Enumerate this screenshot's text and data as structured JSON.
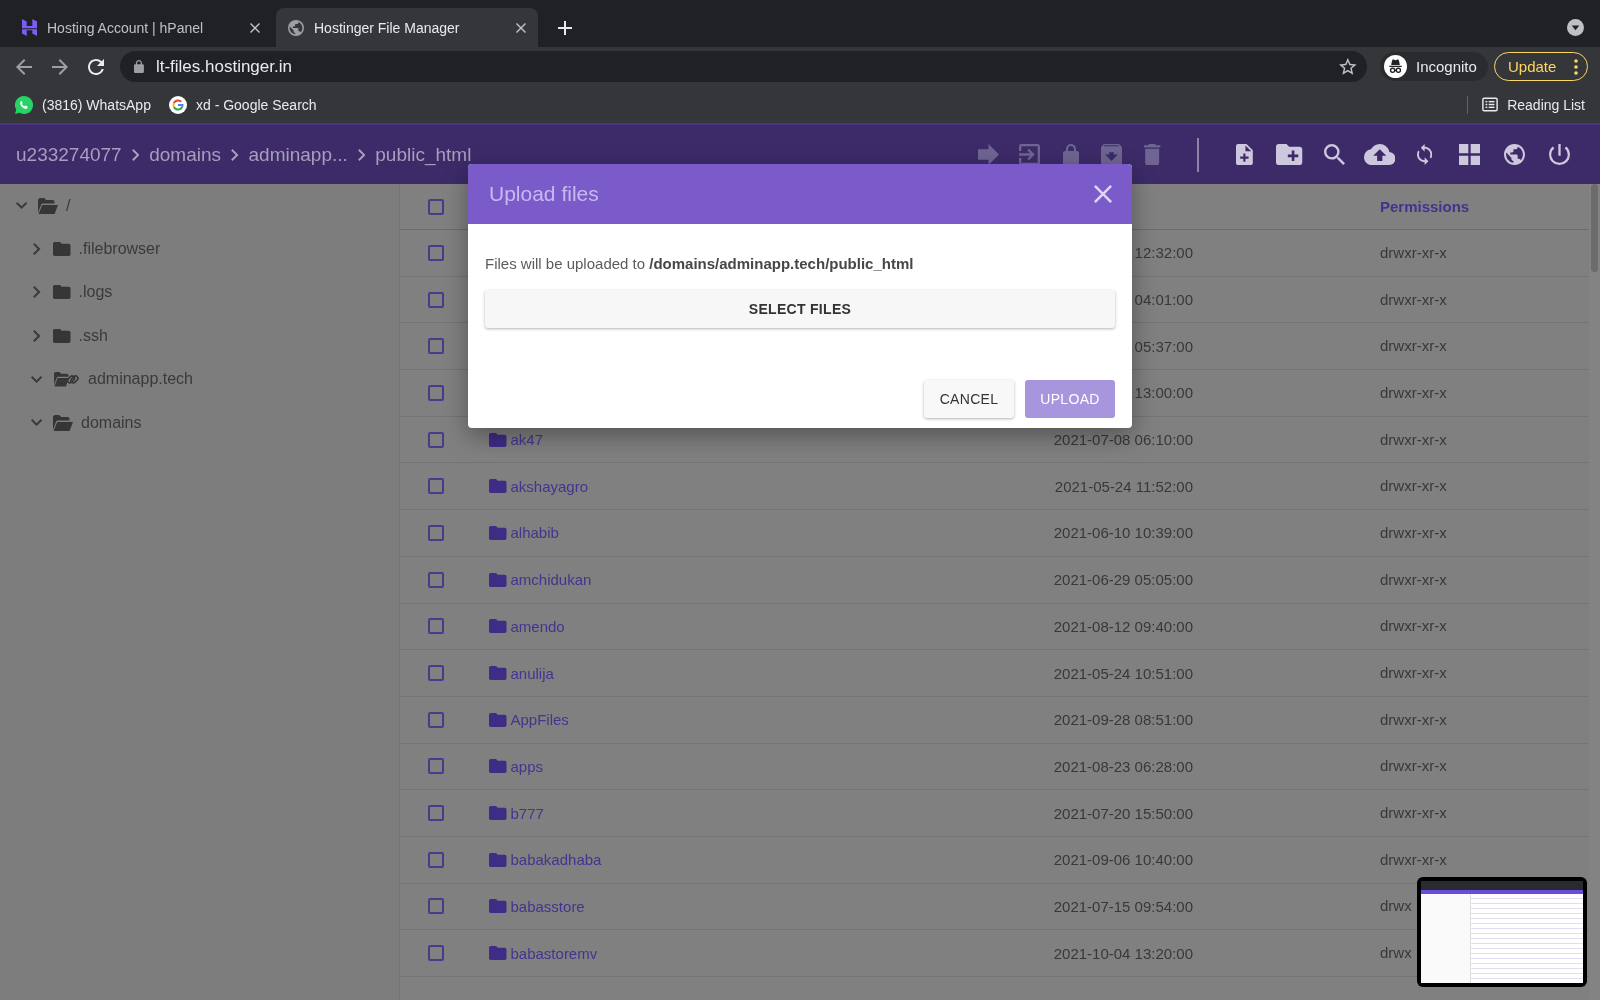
{
  "browser": {
    "tabs": [
      {
        "title": "Hosting Account | hPanel",
        "selected": false
      },
      {
        "title": "Hostinger File Manager",
        "selected": true
      }
    ],
    "url": "lt-files.hostinger.in",
    "profile_label": "Incognito",
    "update_label": "Update",
    "bookmarks": [
      {
        "label": "(3816) WhatsApp"
      },
      {
        "label": "xd - Google Search"
      }
    ],
    "reading_list": "Reading List"
  },
  "file_manager": {
    "breadcrumbs": [
      "u233274077",
      "domains",
      "adminapp...",
      "public_html"
    ],
    "toolbar": [
      {
        "disabled": true
      },
      {
        "disabled": true
      },
      {
        "disabled": true
      },
      {
        "disabled": true
      },
      {
        "disabled": true
      },
      {
        "disabled": false
      },
      {
        "disabled": false
      },
      {
        "disabled": false
      },
      {
        "disabled": false
      },
      {
        "disabled": false
      },
      {
        "disabled": false
      },
      {
        "disabled": false
      },
      {
        "disabled": false
      }
    ],
    "tree": {
      "label": "/",
      "kind": "folder",
      "expanded": true,
      "children": [
        {
          "label": ".filebrowser",
          "kind": "folder",
          "expanded": false
        },
        {
          "label": ".logs",
          "kind": "folder",
          "expanded": false
        },
        {
          "label": ".ssh",
          "kind": "folder",
          "expanded": false
        },
        {
          "label": "adminapp.tech",
          "kind": "link",
          "expanded": true
        },
        {
          "label": "domains",
          "kind": "folder",
          "expanded": true
        }
      ]
    },
    "table": {
      "header": {
        "checked": false,
        "permissions": "Permissions"
      },
      "rows": [
        {
          "checked": false,
          "date": "12:32:00",
          "permissions": "drwxr-xr-x"
        },
        {
          "checked": false,
          "date": "04:01:00",
          "permissions": "drwxr-xr-x"
        },
        {
          "checked": false,
          "date": "05:37:00",
          "permissions": "drwxr-xr-x"
        },
        {
          "checked": false,
          "date": "13:00:00",
          "permissions": "drwxr-xr-x"
        },
        {
          "checked": false,
          "name": "ak47",
          "date": "2021-07-08 06:10:00",
          "permissions": "drwxr-xr-x"
        },
        {
          "checked": false,
          "name": "akshayagro",
          "date": "2021-05-24 11:52:00",
          "permissions": "drwxr-xr-x"
        },
        {
          "checked": false,
          "name": "alhabib",
          "date": "2021-06-10 10:39:00",
          "permissions": "drwxr-xr-x"
        },
        {
          "checked": false,
          "name": "amchidukan",
          "date": "2021-06-29 05:05:00",
          "permissions": "drwxr-xr-x"
        },
        {
          "checked": false,
          "name": "amendo",
          "date": "2021-08-12 09:40:00",
          "permissions": "drwxr-xr-x"
        },
        {
          "checked": false,
          "name": "anulija",
          "date": "2021-05-24 10:51:00",
          "permissions": "drwxr-xr-x"
        },
        {
          "checked": false,
          "name": "AppFiles",
          "date": "2021-09-28 08:51:00",
          "permissions": "drwxr-xr-x"
        },
        {
          "checked": false,
          "name": "apps",
          "date": "2021-08-23 06:28:00",
          "permissions": "drwxr-xr-x"
        },
        {
          "checked": false,
          "name": "b777",
          "date": "2021-07-20 15:50:00",
          "permissions": "drwxr-xr-x"
        },
        {
          "checked": false,
          "name": "babakadhaba",
          "date": "2021-09-06 10:40:00",
          "permissions": "drwxr-xr-x"
        },
        {
          "checked": false,
          "name": "babasstore",
          "date": "2021-07-15 09:54:00",
          "permissions": "drwx"
        },
        {
          "checked": false,
          "name": "babastoremv",
          "date": "2021-10-04 13:20:00",
          "permissions": "drwx"
        }
      ]
    }
  },
  "dialog": {
    "title": "Upload files",
    "message": "Files will be uploaded to **/domains/adminapp.tech/public_html**",
    "select_label": "SELECT FILES",
    "buttons": [
      {
        "label": "CANCEL",
        "kind": "secondary",
        "disabled": false
      },
      {
        "label": "UPLOAD",
        "kind": "primary",
        "disabled": true
      }
    ]
  }
}
